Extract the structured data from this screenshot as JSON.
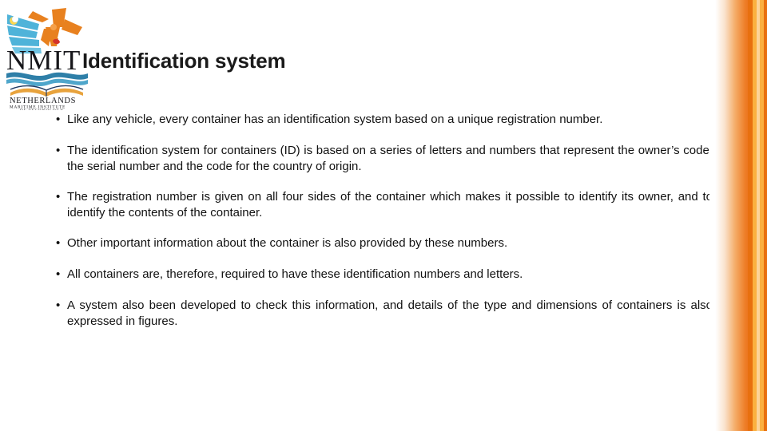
{
  "slide": {
    "title": "Identification system",
    "background_color": "#ffffff",
    "text_color": "#111111"
  },
  "logo": {
    "name": "NMIT",
    "acronym": "NMIT",
    "line1": "NETHERLANDS",
    "line2": "MARITIME INSTITUTE",
    "line3": "OF TECHNOLOGY",
    "colors": {
      "windmill_orange": "#E8811F",
      "ray_blue": "#4FB3D9",
      "wave_blue": "#2E7FA8",
      "text_dark": "#1A1A1A",
      "accent_red": "#D3322B"
    }
  },
  "decoration": {
    "accent_color": "#E8700F",
    "accent_light": "#FBB040",
    "accent_pale": "#FCD39A"
  },
  "bullets": [
    {
      "marker": "•",
      "text": "Like any vehicle, every container has an identification system based on a unique registration number."
    },
    {
      "marker": "•",
      "text": "The identification system for containers (ID) is based on a series of letters and numbers that represent the owner’s code, the serial number and the code for the country of origin."
    },
    {
      "marker": "•",
      "text": "The registration number is given on all four sides of the container which makes it possible to identify its owner, and to identify the contents of the container."
    },
    {
      "marker": "•",
      "text": "Other important information about the container is also provided by these numbers."
    },
    {
      "marker": "•",
      "text": "All containers are, therefore, required to have these identification numbers and letters."
    },
    {
      "marker": "•",
      "text": "A system also been developed to check this information, and details of the type and dimensions of containers is also expressed in figures."
    }
  ]
}
